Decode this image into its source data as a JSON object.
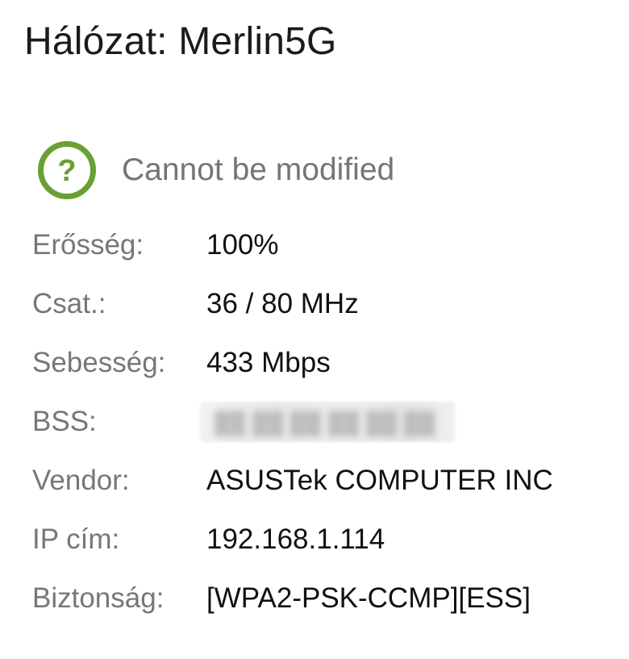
{
  "dialog": {
    "title": "Hálózat: Merlin5G"
  },
  "status": {
    "icon": "question-circle-icon",
    "icon_color": "#6a9f35",
    "text": "Cannot be modified"
  },
  "details": [
    {
      "label": "Erősség:",
      "value": "100%"
    },
    {
      "label": "Csat.:",
      "value": "36 / 80 MHz"
    },
    {
      "label": "Sebesség:",
      "value": "433 Mbps"
    },
    {
      "label": "BSS:",
      "value": "",
      "redacted": true
    },
    {
      "label": "Vendor:",
      "value": "ASUSTek COMPUTER INC"
    },
    {
      "label": "IP cím:",
      "value": "192.168.1.114"
    },
    {
      "label": "Biztonság:",
      "value": "[WPA2-PSK-CCMP][ESS]"
    }
  ]
}
